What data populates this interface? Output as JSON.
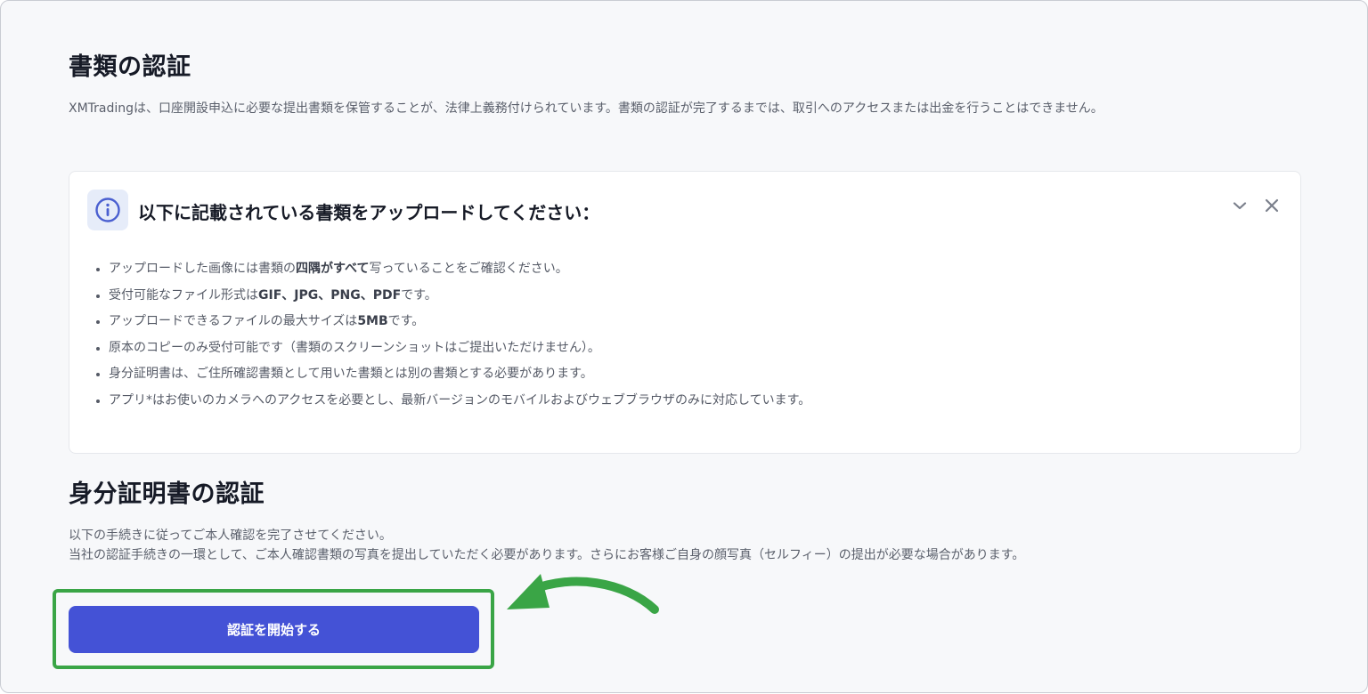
{
  "document_section": {
    "title": "書類の認証",
    "description": "XMTradingは、口座開設申込に必要な提出書類を保管することが、法律上義務付けられています。書類の認証が完了するまでは、取引へのアクセスまたは出金を行うことはできません。"
  },
  "info_card": {
    "icon": "info-icon",
    "heading": "以下に記載されている書類をアップロードしてください：",
    "collapse_icon": "chevron-down-icon",
    "close_icon": "close-icon",
    "items": [
      {
        "pre": "アップロードした画像には書類の",
        "bold": "四隅がすべて",
        "post": "写っていることをご確認ください。"
      },
      {
        "pre": "受付可能なファイル形式は",
        "bold": "GIF、JPG、PNG、PDF",
        "post": "です。"
      },
      {
        "pre": "アップロードできるファイルの最大サイズは",
        "bold": "5MB",
        "post": "です。"
      },
      {
        "pre": "原本のコピーのみ受付可能です（書類のスクリーンショットはご提出いただけません）。",
        "bold": "",
        "post": ""
      },
      {
        "pre": "身分証明書は、ご住所確認書類として用いた書類とは別の書類とする必要があります。",
        "bold": "",
        "post": ""
      },
      {
        "pre": "アプリ*はお使いのカメラへのアクセスを必要とし、最新バージョンのモバイルおよびウェブブラウザのみに対応しています。",
        "bold": "",
        "post": ""
      }
    ]
  },
  "id_section": {
    "title": "身分証明書の認証",
    "line1": "以下の手続きに従ってご本人確認を完了させてください。",
    "line2": "当社の認証手続きの一環として、ご本人確認書類の写真を提出していただく必要があります。さらにお客様ご自身の顔写真（セルフィー）の提出が必要な場合があります。",
    "button_label": "認証を開始する"
  },
  "colors": {
    "button": "#4452d6",
    "highlight": "#3aa546",
    "info_icon": "#4a5fd0"
  }
}
